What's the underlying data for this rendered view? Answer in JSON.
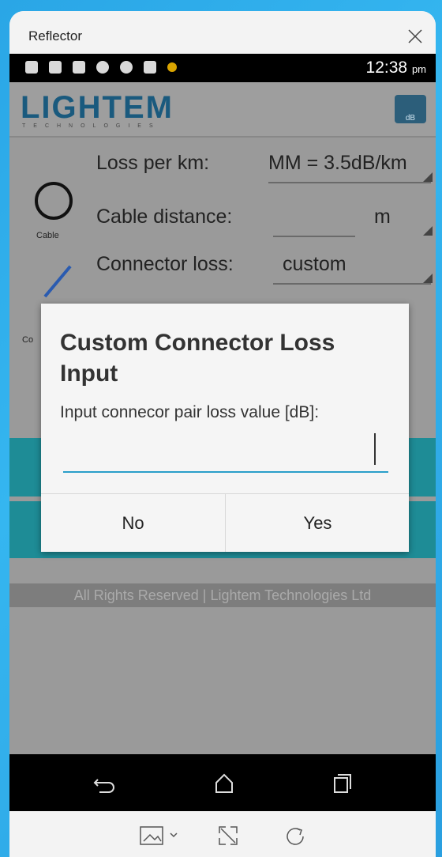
{
  "window": {
    "title": "Reflector"
  },
  "status_bar": {
    "time": "12:38",
    "ampm": "pm"
  },
  "app": {
    "logo_text": "LIGHTEM",
    "logo_sub": "TECHNOLOGIES",
    "badge": "dB",
    "cable_label": "Cable",
    "connector_label": "Co",
    "rows": {
      "loss_per_km": {
        "label": "Loss per km:",
        "value": "MM = 3.5dB/km"
      },
      "cable_distance": {
        "label": "Cable distance:",
        "unit": "m"
      },
      "connector_loss": {
        "label": "Connector loss:",
        "value": "custom"
      }
    },
    "footer": "All Rights Reserved | Lightem Technologies Ltd"
  },
  "dialog": {
    "title": "Custom Connector Loss Input",
    "message": "Input connecor pair loss value [dB]:",
    "input_value": "",
    "no_label": "No",
    "yes_label": "Yes"
  },
  "icons": [
    "close-icon",
    "back-icon",
    "home-icon",
    "recents-icon",
    "screenshot-icon",
    "fullscreen-icon",
    "rotate-icon"
  ]
}
